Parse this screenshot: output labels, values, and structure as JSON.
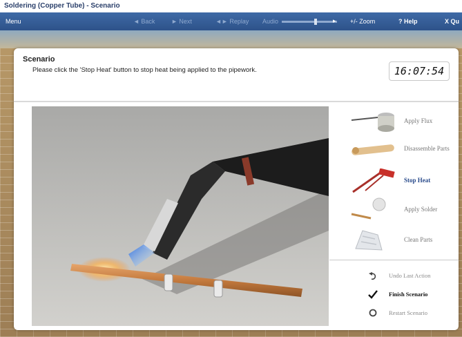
{
  "window": {
    "title": "Soldering (Copper Tube) - Scenario"
  },
  "toolbar": {
    "menu": "Menu",
    "back": "◄ Back",
    "next": "► Next",
    "replay": "◄► Replay",
    "audio": "Audio",
    "zoom": "+/- Zoom",
    "help": "? Help",
    "quit": "X Qu"
  },
  "scenario": {
    "heading": "Scenario",
    "instruction": "Please click the 'Stop Heat' button to stop heat being applied to the pipework.",
    "clock": "16:07:54"
  },
  "tools": [
    {
      "label": "Apply Flux",
      "icon": "flux-pot-icon"
    },
    {
      "label": "Disassemble Parts",
      "icon": "tube-parts-icon"
    },
    {
      "label": "Stop Heat",
      "icon": "torch-icon",
      "active": true
    },
    {
      "label": "Apply Solder",
      "icon": "solder-wire-icon"
    },
    {
      "label": "Clean Parts",
      "icon": "cleaning-cloth-icon"
    }
  ],
  "actions": [
    {
      "label": "Undo Last Action",
      "icon": "undo-arrow-icon"
    },
    {
      "label": "Finish Scenario",
      "icon": "check-icon"
    },
    {
      "label": "Restart Scenario",
      "icon": "restart-circle-icon"
    }
  ],
  "colors": {
    "toolbar": "#345b96",
    "active_tool": "#2b4c8c",
    "title": "#2a3f6a"
  }
}
